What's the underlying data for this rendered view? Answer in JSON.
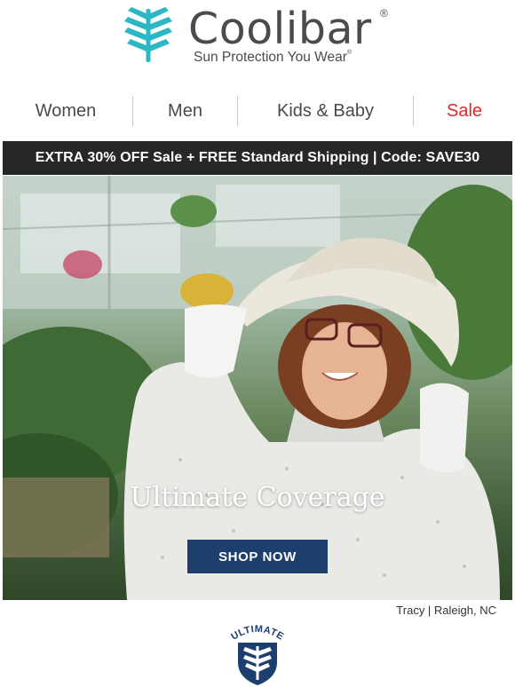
{
  "brand": {
    "name": "Coolibar",
    "registered": "®",
    "tagline": "Sun Protection You Wear",
    "tagline_registered": "®",
    "logo_icon": "palm-leaf-icon",
    "accent_color": "#2bb8c4"
  },
  "nav": {
    "items": [
      {
        "label": "Women",
        "color": "#4a4a4a"
      },
      {
        "label": "Men",
        "color": "#4a4a4a"
      },
      {
        "label": "Kids & Baby",
        "color": "#4a4a4a"
      },
      {
        "label": "Sale",
        "color": "#e3262b"
      }
    ]
  },
  "promo": {
    "text": "EXTRA 30% OFF Sale + FREE Standard Shipping | Code: SAVE30"
  },
  "hero": {
    "title": "Ultimate Coverage",
    "cta_label": "SHOP NOW",
    "cta_color": "#1d3f6e"
  },
  "credit": {
    "text": "Tracy  |  Raleigh, NC"
  },
  "badge": {
    "text": "ULTIMATE",
    "icon": "shield-leaf-icon",
    "color": "#1d3f6e"
  }
}
